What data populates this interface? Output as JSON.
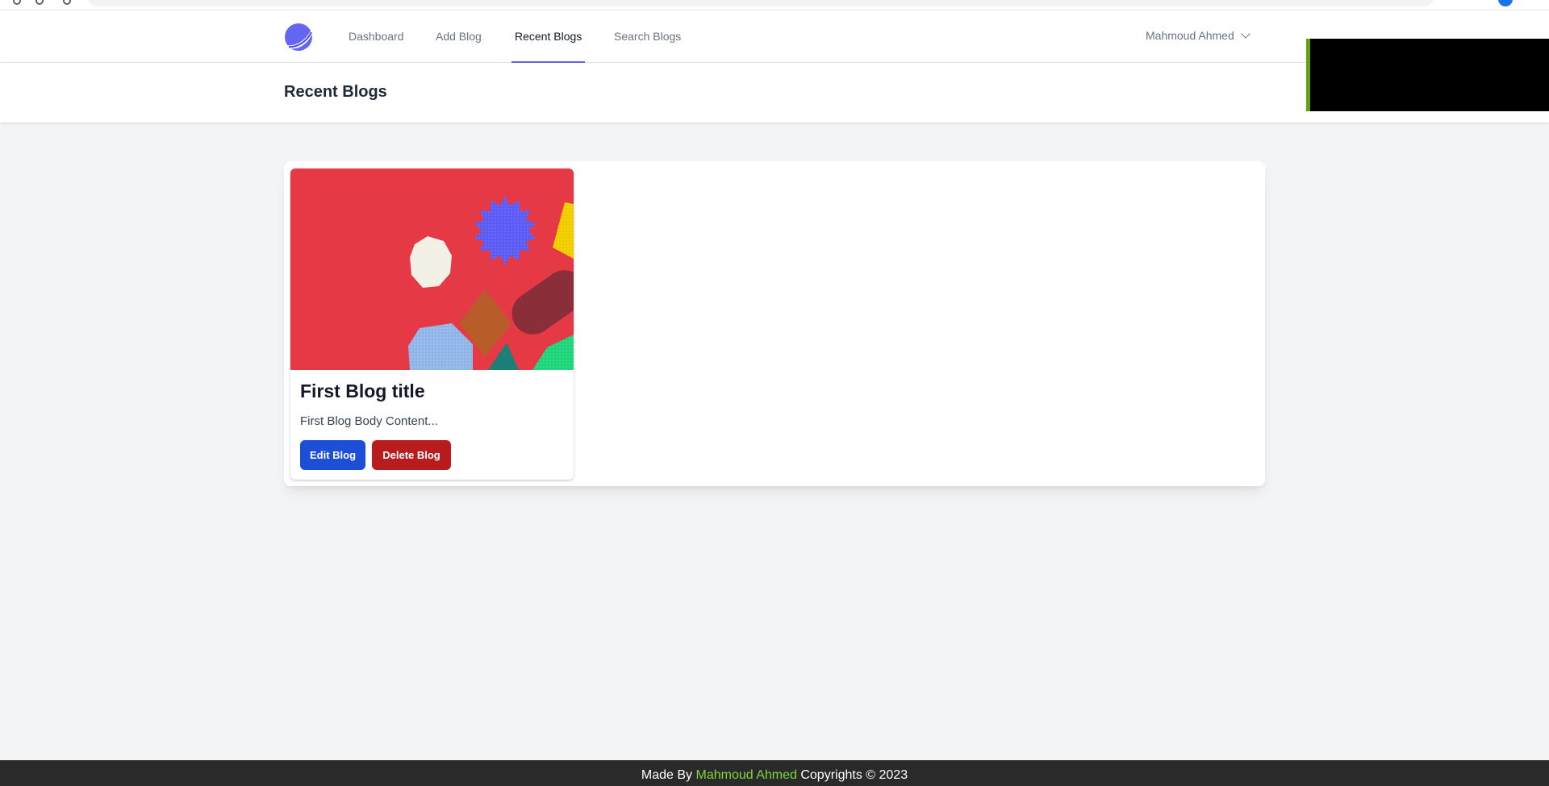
{
  "nav": {
    "links": [
      {
        "label": "Dashboard",
        "active": false
      },
      {
        "label": "Add Blog",
        "active": false
      },
      {
        "label": "Recent Blogs",
        "active": true
      },
      {
        "label": "Search Blogs",
        "active": false
      }
    ],
    "user_name": "Mahmoud Ahmed"
  },
  "header": {
    "title": "Recent Blogs"
  },
  "blogs": [
    {
      "title": "First Blog title",
      "body": "First Blog Body Content...",
      "edit_label": "Edit Blog",
      "delete_label": "Delete Blog"
    }
  ],
  "footer": {
    "prefix": "Made By",
    "author": "Mahmoud Ahmed",
    "suffix": "Copyrights © 2023"
  },
  "colors": {
    "accent": "#6366f1",
    "edit_button": "#1d4ed8",
    "delete_button": "#b91c1c",
    "footer_bg": "#2a2a2a",
    "footer_author": "#7dd63a",
    "card_image_bg": "#e63946"
  },
  "icons": {
    "logo": "planet-logo-icon",
    "user_dropdown": "chevron-down-icon"
  }
}
